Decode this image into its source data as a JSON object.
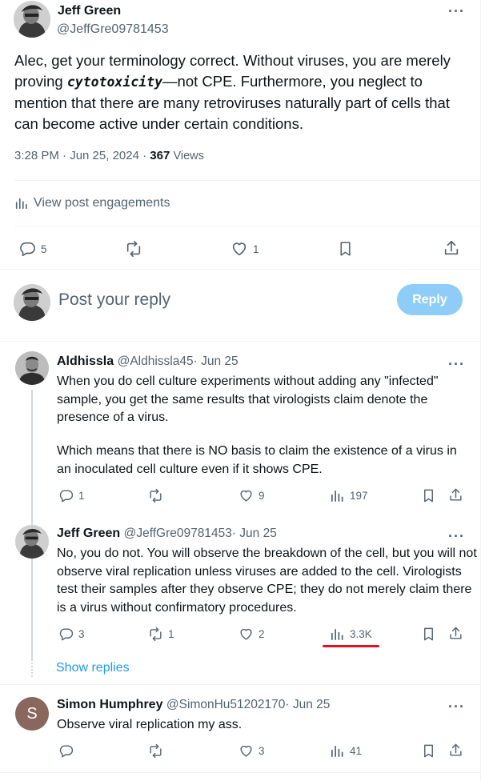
{
  "main_post": {
    "author_name": "Jeff Green",
    "author_handle": "@JeffGre09781453",
    "text_part1": "Alec, get your terminology correct. Without viruses, you are merely proving ",
    "text_emphasis": "cytotoxicity",
    "text_part2": "—not CPE. Furthermore, you neglect to mention that there are many retroviruses naturally part of cells that can become active under certain conditions.",
    "time": "3:28 PM · Jun 25, 2024 · ",
    "views_count": "367",
    "views_label": "Views",
    "engagements_label": "View post engagements",
    "replies": "5",
    "reposts": "",
    "likes": "1"
  },
  "reply_composer": {
    "placeholder": "Post your reply",
    "button_label": "Reply"
  },
  "replies": [
    {
      "author_name": "Aldhissla",
      "author_handle": "@Aldhissla45",
      "date": "· Jun 25",
      "text": "When you do cell culture experiments without adding any \"infected\" sample, you get the same results that virologists claim denote the presence of a virus.",
      "text2": "Which means that there is NO basis to claim the existence of a virus in an inoculated cell culture even if it shows CPE.",
      "replies": "1",
      "reposts": "",
      "likes": "9",
      "views": "197"
    },
    {
      "author_name": "Jeff Green",
      "author_handle": "@JeffGre09781453",
      "date": "· Jun 25",
      "text": "No, you do not. You will observe the breakdown of the cell, but you will not observe viral replication unless viruses are added to the cell. Virologists test their samples after they observe CPE; they do not merely claim there is a virus without confirmatory procedures.",
      "replies": "3",
      "reposts": "1",
      "likes": "2",
      "views": "3.3K"
    },
    {
      "author_name": "Simon Humphrey",
      "author_handle": "@SimonHu51202170",
      "date": "· Jun 25",
      "avatar_letter": "S",
      "text": "Observe viral replication my ass.",
      "replies": "",
      "reposts": "",
      "likes": "3",
      "views": "41"
    }
  ],
  "show_replies_label": "Show replies",
  "more_glyph": "···",
  "colors": {
    "accent": "#1d9bf0",
    "reply_button_disabled": "#8ecdf7",
    "annotation_underline": "#e0121d",
    "simon_avatar": "#8a675c"
  }
}
